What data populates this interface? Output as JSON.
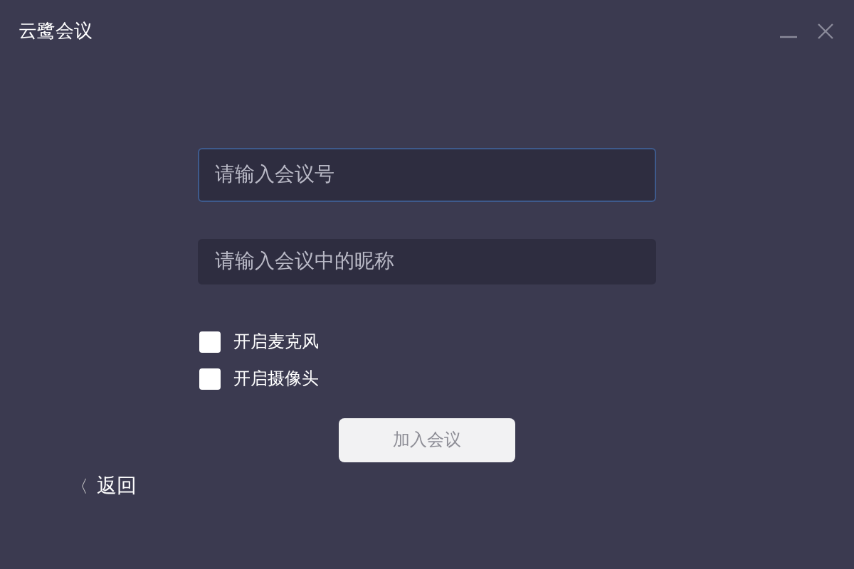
{
  "window": {
    "title": "云鹭会议"
  },
  "fields": [
    {
      "placeholder": "请输入会议号",
      "focused": true
    },
    {
      "placeholder": "请输入会议中的昵称",
      "focused": false
    }
  ],
  "options": [
    {
      "label": "开启麦克风",
      "checked": false
    },
    {
      "label": "开启摄像头",
      "checked": false
    }
  ],
  "join_button": {
    "label": "加入会议",
    "disabled": true
  },
  "back": {
    "icon": "〈",
    "label": "返回"
  }
}
